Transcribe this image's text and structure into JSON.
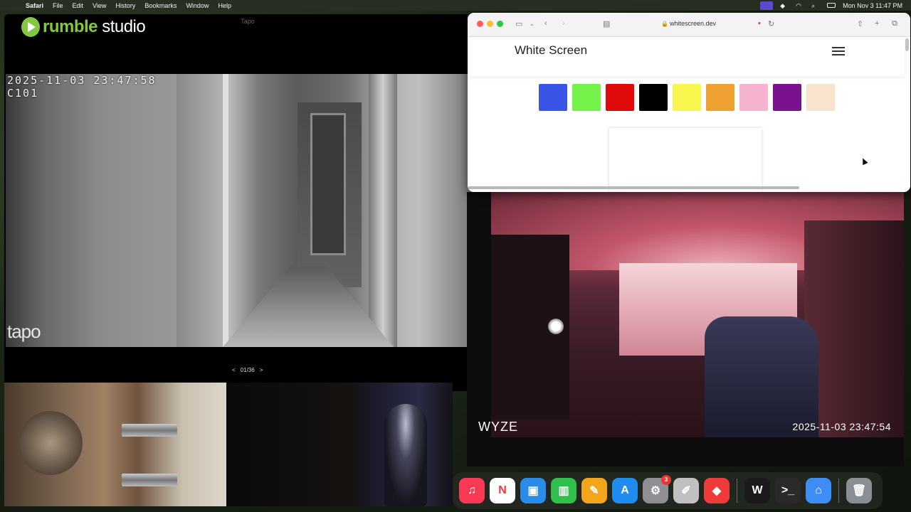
{
  "menubar": {
    "app_name": "Safari",
    "menus": [
      "File",
      "Edit",
      "View",
      "History",
      "Bookmarks",
      "Window",
      "Help"
    ],
    "datetime": "Mon Nov 3  11:47 PM"
  },
  "tapo_window": {
    "title": "Tapo",
    "brand_rumble": "rumble",
    "brand_studio": "studio",
    "camera_timestamp": "2025-11-03  23:47:58",
    "camera_id": "C101",
    "watermark": "tapo",
    "pager": {
      "prev": "<",
      "label": "01/36",
      "next": ">"
    }
  },
  "wyze_window": {
    "logo": "WYZE",
    "timestamp": "2025-11-03  23:47:54"
  },
  "safari": {
    "url": "whitescreen.dev",
    "page_title": "White Screen",
    "swatches": [
      {
        "name": "blue",
        "color": "#3a55e6"
      },
      {
        "name": "green",
        "color": "#74f24a"
      },
      {
        "name": "red",
        "color": "#e00a0a"
      },
      {
        "name": "black",
        "color": "#000000"
      },
      {
        "name": "yellow",
        "color": "#f8f54e"
      },
      {
        "name": "orange",
        "color": "#eea130"
      },
      {
        "name": "pink",
        "color": "#f5b3cf"
      },
      {
        "name": "purple",
        "color": "#7a118f"
      },
      {
        "name": "beige",
        "color": "#f8e3cd"
      }
    ]
  },
  "dock": {
    "items": [
      {
        "name": "music",
        "glyph": "♫",
        "color": "#fa3a55"
      },
      {
        "name": "news",
        "glyph": "N",
        "color": "#ffffff"
      },
      {
        "name": "keynote",
        "glyph": "▣",
        "color": "#2a8ce8"
      },
      {
        "name": "numbers",
        "glyph": "▥",
        "color": "#2fbf4a"
      },
      {
        "name": "pages",
        "glyph": "✎",
        "color": "#f3a51b"
      },
      {
        "name": "app-store",
        "glyph": "A",
        "color": "#1f8cf0"
      },
      {
        "name": "system-settings",
        "glyph": "⚙",
        "color": "#8e8e93",
        "badge": "3"
      },
      {
        "name": "script-editor",
        "glyph": "✐",
        "color": "#c0c0c0"
      },
      {
        "name": "anydesk",
        "glyph": "◆",
        "color": "#ef3b3b"
      },
      {
        "name": "wsa",
        "glyph": "W",
        "color": "#1a1a1a"
      },
      {
        "name": "terminal",
        "glyph": ">_",
        "color": "#2a2a2a"
      },
      {
        "name": "home",
        "glyph": "⌂",
        "color": "#3d8df5"
      },
      {
        "name": "trash",
        "glyph": "🗑",
        "color": "#8a8f94"
      }
    ]
  }
}
